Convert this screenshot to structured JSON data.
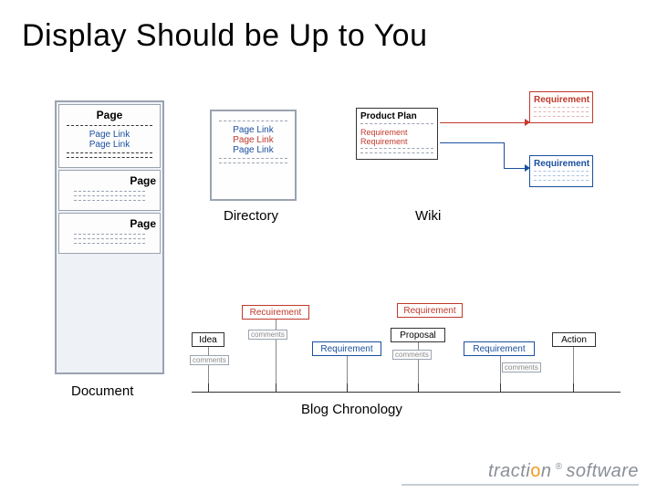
{
  "title": "Display Should be Up to You",
  "labels": {
    "document": "Document",
    "directory": "Directory",
    "wiki": "Wiki",
    "blog": "Blog Chronology"
  },
  "document": {
    "page_heading": "Page",
    "link_label": "Page Link"
  },
  "directory": {
    "link_label": "Page Link"
  },
  "wiki": {
    "plan_title": "Product Plan",
    "plan_lines": [
      "Requirement",
      "Requirement"
    ],
    "req_top": "Requirement",
    "req_mid": "Requirement"
  },
  "blog": {
    "idea": "Idea",
    "recuirement": "Recuirement",
    "requirement": "Requirement",
    "proposal": "Proposal",
    "action": "Action",
    "comments": "comments"
  },
  "logo": {
    "t1": "tracti",
    "acc": "o",
    "t2": "n",
    "reg": "®",
    "soft": "software"
  }
}
